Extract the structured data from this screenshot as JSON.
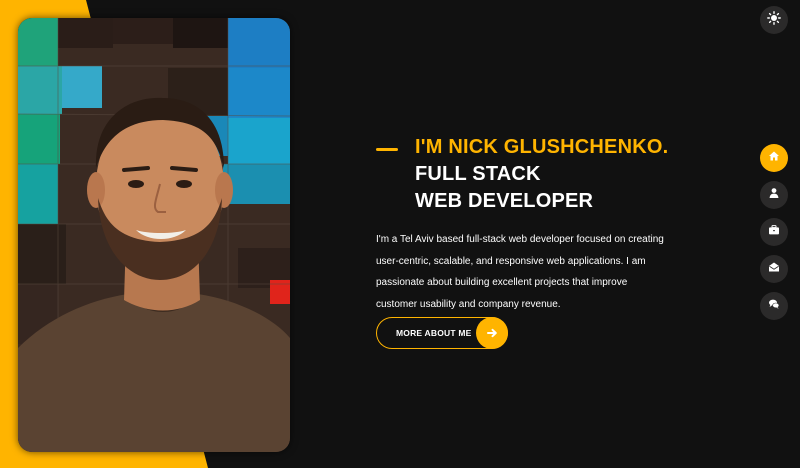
{
  "hero": {
    "title_line1": "I'M NICK GLUSHCHENKO.",
    "title_line2": "FULL STACK",
    "title_line3": "WEB DEVELOPER",
    "bio": "I'm a Tel Aviv based full-stack web developer focused on creating user-centric, scalable, and responsive web applications. I am passionate about building excellent projects that improve customer usability and company revenue.",
    "cta_label": "MORE ABOUT ME",
    "cta_icon": "arrow-right-icon"
  },
  "theme_toggle": {
    "icon": "sun-icon"
  },
  "nav": {
    "items": [
      {
        "id": "home",
        "icon": "home-icon",
        "active": true
      },
      {
        "id": "about",
        "icon": "user-icon",
        "active": false
      },
      {
        "id": "portfolio",
        "icon": "briefcase-icon",
        "active": false
      },
      {
        "id": "contact",
        "icon": "envelope-open-icon",
        "active": false
      },
      {
        "id": "blog",
        "icon": "comments-icon",
        "active": false
      }
    ]
  },
  "colors": {
    "accent": "#ffb400",
    "background": "#111111",
    "nav_button": "#2b2a2a",
    "text": "#ffffff"
  }
}
